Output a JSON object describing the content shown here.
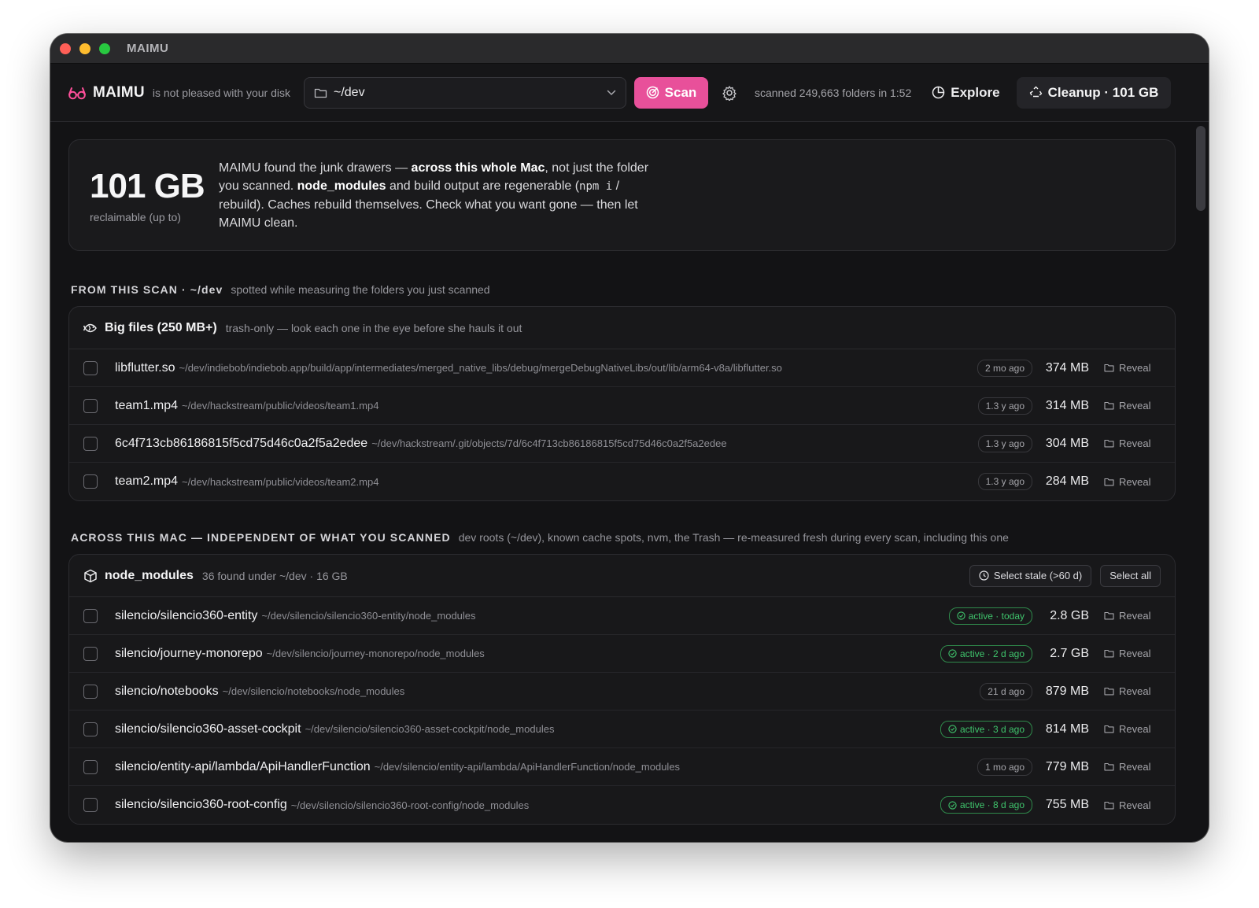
{
  "window": {
    "title": "MAIMU"
  },
  "toolbar": {
    "brand": "MAIMU",
    "tagline": "is not pleased with your disk",
    "path_value": "~/dev",
    "scan_label": "Scan",
    "scanned_status": "scanned 249,663 folders in 1:52",
    "explore_label": "Explore",
    "cleanup_label": "Cleanup · 101 GB"
  },
  "summary": {
    "amount": "101 GB",
    "amount_caption": "reclaimable (up to)",
    "desc": {
      "p1": "MAIMU found the junk drawers — ",
      "b1": "across this whole Mac",
      "p2": ", not just the folder you scanned. ",
      "b2": "node_modules",
      "p3": " and build output are regenerable (",
      "c1": "npm i",
      "p4": " / rebuild). Caches rebuild themselves. Check what you want gone — then let MAIMU clean."
    }
  },
  "scan_section": {
    "heading": "FROM THIS SCAN · ~/dev",
    "note": "spotted while measuring the folders you just scanned"
  },
  "big_files": {
    "title": "Big files (250 MB+)",
    "subtitle": "trash-only — look each one in the eye before she hauls it out",
    "rows": [
      {
        "name": "libflutter.so",
        "path": "~/dev/indiebob/indiebob.app/build/app/intermediates/merged_native_libs/debug/mergeDebugNativeLibs/out/lib/arm64-v8a/libflutter.so",
        "age": "2 mo ago",
        "size": "374 MB",
        "reveal": "Reveal"
      },
      {
        "name": "team1.mp4",
        "path": "~/dev/hackstream/public/videos/team1.mp4",
        "age": "1.3 y ago",
        "size": "314 MB",
        "reveal": "Reveal"
      },
      {
        "name": "6c4f713cb86186815f5cd75d46c0a2f5a2edee",
        "path": "~/dev/hackstream/.git/objects/7d/6c4f713cb86186815f5cd75d46c0a2f5a2edee",
        "age": "1.3 y ago",
        "size": "304 MB",
        "reveal": "Reveal"
      },
      {
        "name": "team2.mp4",
        "path": "~/dev/hackstream/public/videos/team2.mp4",
        "age": "1.3 y ago",
        "size": "284 MB",
        "reveal": "Reveal"
      }
    ]
  },
  "mac_section": {
    "heading": "ACROSS THIS MAC — INDEPENDENT OF WHAT YOU SCANNED",
    "note": "dev roots (~/dev), known cache spots, nvm, the Trash — re-measured fresh during every scan, including this one"
  },
  "node_modules": {
    "title": "node_modules",
    "subtitle": "36 found under ~/dev · 16 GB",
    "select_stale": "Select stale (>60 d)",
    "select_all": "Select all",
    "rows": [
      {
        "name": "silencio/silencio360-entity",
        "path": "~/dev/silencio/silencio360-entity/node_modules",
        "age": "active · today",
        "active": true,
        "size": "2.8 GB",
        "reveal": "Reveal"
      },
      {
        "name": "silencio/journey-monorepo",
        "path": "~/dev/silencio/journey-monorepo/node_modules",
        "age": "active · 2 d ago",
        "active": true,
        "size": "2.7 GB",
        "reveal": "Reveal"
      },
      {
        "name": "silencio/notebooks",
        "path": "~/dev/silencio/notebooks/node_modules",
        "age": "21 d ago",
        "active": false,
        "size": "879 MB",
        "reveal": "Reveal"
      },
      {
        "name": "silencio/silencio360-asset-cockpit",
        "path": "~/dev/silencio/silencio360-asset-cockpit/node_modules",
        "age": "active · 3 d ago",
        "active": true,
        "size": "814 MB",
        "reveal": "Reveal"
      },
      {
        "name": "silencio/entity-api/lambda/ApiHandlerFunction",
        "path": "~/dev/silencio/entity-api/lambda/ApiHandlerFunction/node_modules",
        "age": "1 mo ago",
        "active": false,
        "size": "779 MB",
        "reveal": "Reveal"
      },
      {
        "name": "silencio/silencio360-root-config",
        "path": "~/dev/silencio/silencio360-root-config/node_modules",
        "age": "active · 8 d ago",
        "active": true,
        "size": "755 MB",
        "reveal": "Reveal"
      }
    ]
  },
  "colors": {
    "accent": "#e8509a",
    "active": "#3fc46c",
    "background": "#131315"
  }
}
